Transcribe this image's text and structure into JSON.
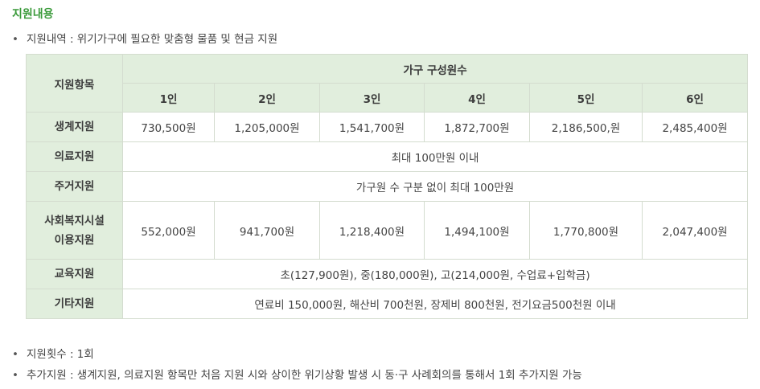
{
  "section_title": "지원내용",
  "bullets": {
    "content": "지원내역 : 위기가구에 필요한 맞춤형 물품 및 현금 지원",
    "count": "지원횟수 : 1회",
    "extra": "추가지원 : 생계지원, 의료지원 항목만 처음 지원 시와 상이한 위기상황 발생 시 동·구 사례회의를 통해서 1회 추가지원 가능"
  },
  "bullet_glyph": "•",
  "table": {
    "corner_header": "지원항목",
    "group_header": "가구 구성원수",
    "columns": [
      "1인",
      "2인",
      "3인",
      "4인",
      "5인",
      "6인"
    ],
    "rows": {
      "living": {
        "label": "생계지원",
        "values": [
          "730,500원",
          "1,205,000원",
          "1,541,700원",
          "1,872,700원",
          "2,186,500,원",
          "2,485,400원"
        ]
      },
      "medical": {
        "label": "의료지원",
        "value": "최대 100만원 이내"
      },
      "housing": {
        "label": "주거지원",
        "value": "가구원 수 구분 없이 최대 100만원"
      },
      "welfare": {
        "label_line1": "사회복지시설",
        "label_line2": "이용지원",
        "values": [
          "552,000원",
          "941,700원",
          "1,218,400원",
          "1,494,100원",
          "1,770,800원",
          "2,047,400원"
        ]
      },
      "education": {
        "label": "교육지원",
        "value": "초(127,900원), 중(180,000원), 고(214,000원, 수업료+입학금)"
      },
      "other": {
        "label": "기타지원",
        "value": "연료비 150,000원, 해산비 700천원, 장제비 800천원, 전기요금500천원 이내"
      }
    }
  },
  "colors": {
    "title_green": "#3a9a3a",
    "header_bg": "#e1eedd",
    "border": "#d4dccf"
  }
}
